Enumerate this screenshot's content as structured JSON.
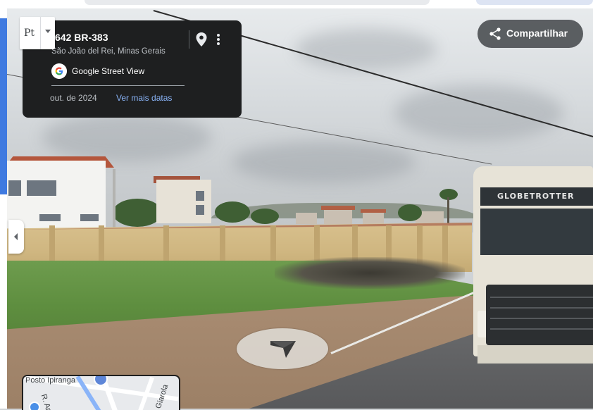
{
  "location": {
    "address_title": "642 BR-383",
    "address_subtitle": "São João del Rei, Minas Gerais",
    "source_label": "Google Street View",
    "capture_date": "out. de 2024",
    "more_dates_link": "Ver mais datas"
  },
  "language_selector": {
    "label": "Pt"
  },
  "actions": {
    "share_label": "Compartilhar"
  },
  "scene": {
    "truck_brand": "GLOBETROTTER"
  },
  "mini_map": {
    "poi_label": "Posto Ipiranga",
    "street_label_left": "R. Ar",
    "street_label_right": "Giarola"
  },
  "icons": {
    "pin": "location-pin-icon",
    "more": "more-vertical-icon",
    "share": "share-icon",
    "google": "google-logo-icon",
    "collapse": "chevron-left-icon",
    "navigate": "navigation-arrow-icon"
  },
  "colors": {
    "card_background": "#1e1f20",
    "link_blue": "#8ab4f8",
    "share_button_bg": "#3c4043"
  }
}
